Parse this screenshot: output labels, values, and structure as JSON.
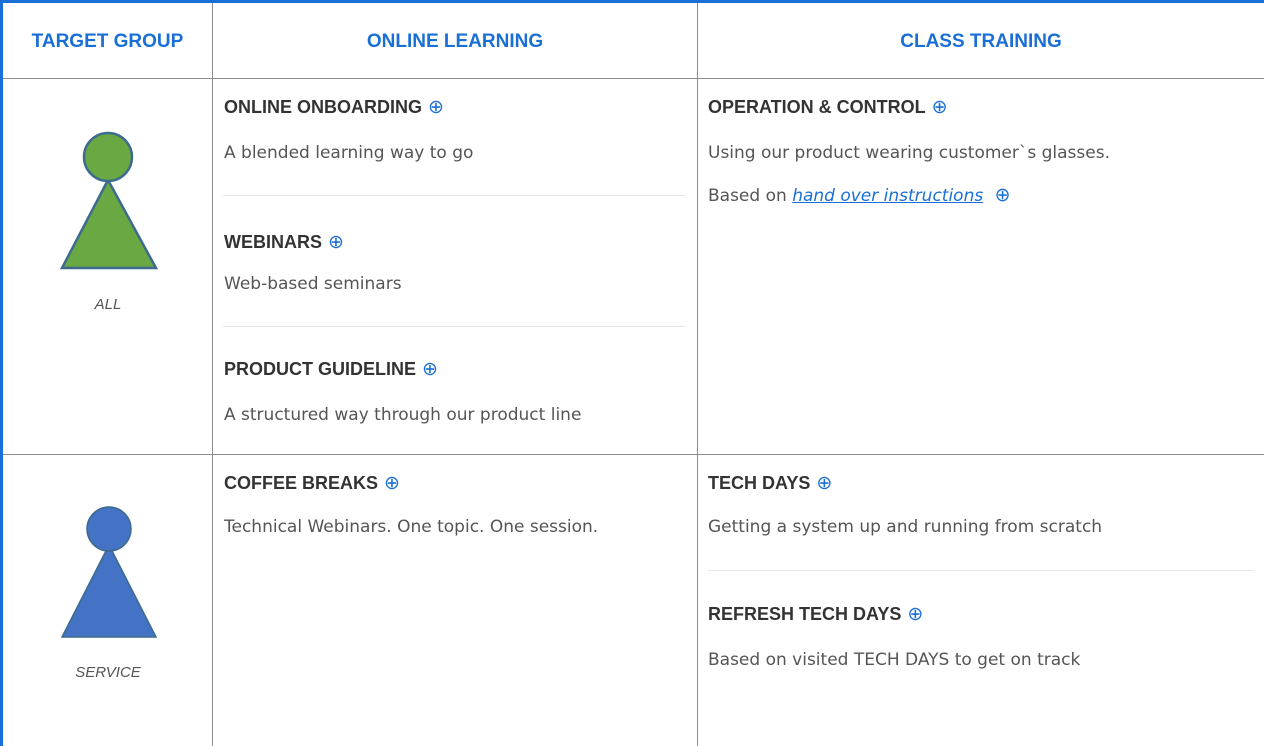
{
  "colors": {
    "accent": "#1a6fd6",
    "green_person": "#6aa843",
    "blue_person": "#4472c4"
  },
  "header": {
    "target_group": "TARGET GROUP",
    "online_learning": "ONLINE LEARNING",
    "class_training": "CLASS TRAINING"
  },
  "plus_glyph": "⊕",
  "rows": {
    "all": {
      "label": "ALL",
      "online": [
        {
          "title": "ONLINE ONBOARDING",
          "desc": "A blended learning way to go"
        },
        {
          "title": "WEBINARS",
          "desc": "Web-based seminars"
        },
        {
          "title": "PRODUCT GUIDELINE",
          "desc": "A structured way through our product line"
        }
      ],
      "class": {
        "title": "OPERATION & CONTROL",
        "desc": "Using our product wearing customer`s glasses.",
        "based_prefix": "Based on",
        "based_link": "hand over instructions"
      }
    },
    "service": {
      "label": "SERVICE",
      "online": [
        {
          "title": "COFFEE BREAKS",
          "desc": "Technical Webinars. One topic. One session."
        }
      ],
      "class": [
        {
          "title": "TECH DAYS",
          "desc": "Getting a system up and running from scratch"
        },
        {
          "title": "REFRESH TECH DAYS",
          "desc": "Based on visited TECH DAYS to get on track"
        }
      ]
    }
  }
}
